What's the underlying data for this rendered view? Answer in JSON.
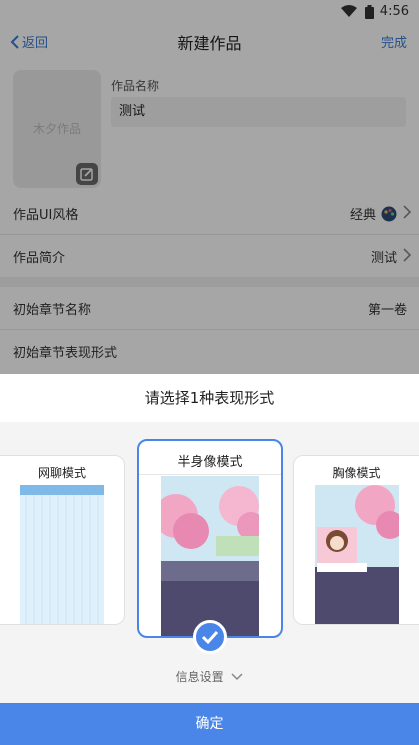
{
  "status_bar": {
    "time": "4:56"
  },
  "nav": {
    "back_label": "返回",
    "title": "新建作品",
    "done_label": "完成"
  },
  "cover": {
    "watermark": "木夕作品"
  },
  "name": {
    "label": "作品名称",
    "value": "测试"
  },
  "rows": [
    {
      "label": "作品UI风格",
      "value": "经典"
    },
    {
      "label": "作品简介",
      "value": "测试"
    },
    {
      "label": "初始章节名称",
      "value": "第一卷"
    },
    {
      "label": "初始章节表现形式",
      "value": ""
    }
  ],
  "sheet": {
    "title": "请选择1种表现形式",
    "modes": [
      {
        "label": "网聊模式",
        "selected": false
      },
      {
        "label": "半身像模式",
        "selected": true
      },
      {
        "label": "胸像模式",
        "selected": false
      }
    ],
    "info_label": "信息设置",
    "confirm_label": "确定"
  },
  "colors": {
    "accent": "#4a86e8",
    "link": "#3a7bd5",
    "overlay": "rgba(0,0,0,0.35)"
  }
}
